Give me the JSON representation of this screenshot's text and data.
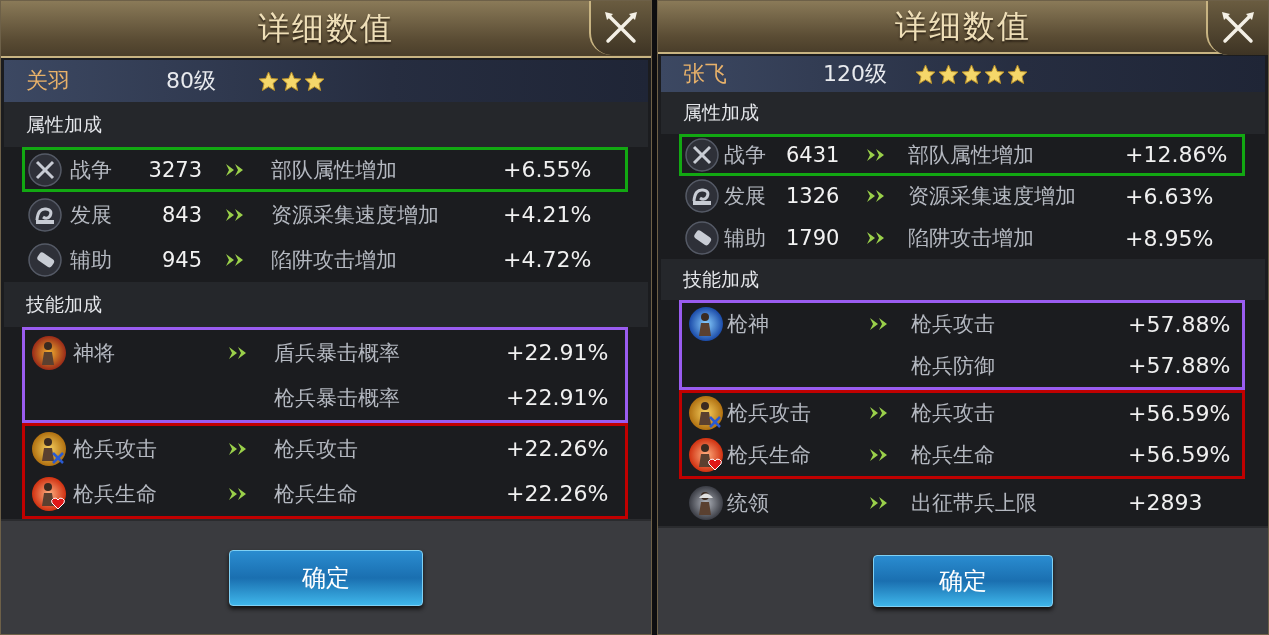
{
  "panels": [
    {
      "title": "详细数值",
      "hero": {
        "name": "关羽",
        "level": "80级",
        "stars": 3
      },
      "attributes": {
        "title": "属性加成",
        "rows": [
          {
            "kind": "war",
            "name": "战争",
            "points": "3273",
            "effect": "部队属性增加",
            "value": "+6.55%",
            "color": "#12a812"
          },
          {
            "kind": "development",
            "name": "发展",
            "points": "843",
            "effect": "资源采集速度增加",
            "value": "+4.21%"
          },
          {
            "kind": "support",
            "name": "辅助",
            "points": "945",
            "effect": "陷阱攻击增加",
            "value": "+4.72%"
          }
        ]
      },
      "skills": {
        "title": "技能加成",
        "groups": [
          {
            "color": "#9a5cf0",
            "skills": [
              {
                "kind": "general",
                "name": "神将",
                "effects": [
                  {
                    "effect": "盾兵暴击概率",
                    "value": "+22.91%"
                  },
                  {
                    "effect": "枪兵暴击概率",
                    "value": "+22.91%"
                  }
                ]
              }
            ]
          },
          {
            "color": "#c00000",
            "skills": [
              {
                "kind": "spear_attack",
                "name": "枪兵攻击",
                "effects": [
                  {
                    "effect": "枪兵攻击",
                    "value": "+22.26%"
                  }
                ]
              },
              {
                "kind": "spear_life",
                "name": "枪兵生命",
                "effects": [
                  {
                    "effect": "枪兵生命",
                    "value": "+22.26%"
                  }
                ]
              }
            ]
          }
        ]
      },
      "button": "确定"
    },
    {
      "title": "详细数值",
      "hero": {
        "name": "张飞",
        "level": "120级",
        "stars": 5
      },
      "attributes": {
        "title": "属性加成",
        "rows": [
          {
            "kind": "war",
            "name": "战争",
            "points": "6431",
            "effect": "部队属性增加",
            "value": "+12.86%",
            "color": "#12a812"
          },
          {
            "kind": "development",
            "name": "发展",
            "points": "1326",
            "effect": "资源采集速度增加",
            "value": "+6.63%"
          },
          {
            "kind": "support",
            "name": "辅助",
            "points": "1790",
            "effect": "陷阱攻击增加",
            "value": "+8.95%"
          }
        ]
      },
      "skills": {
        "title": "技能加成",
        "groups": [
          {
            "color": "#9a5cf0",
            "skills": [
              {
                "kind": "spear_god",
                "name": "枪神",
                "effects": [
                  {
                    "effect": "枪兵攻击",
                    "value": "+57.88%"
                  },
                  {
                    "effect": "枪兵防御",
                    "value": "+57.88%"
                  }
                ]
              }
            ]
          },
          {
            "color": "#c00000",
            "skills": [
              {
                "kind": "spear_attack",
                "name": "枪兵攻击",
                "effects": [
                  {
                    "effect": "枪兵攻击",
                    "value": "+56.59%"
                  }
                ]
              },
              {
                "kind": "spear_life",
                "name": "枪兵生命",
                "effects": [
                  {
                    "effect": "枪兵生命",
                    "value": "+56.59%"
                  }
                ]
              }
            ]
          },
          {
            "skills": [
              {
                "kind": "commander",
                "name": "统领",
                "effects": [
                  {
                    "effect": "出征带兵上限",
                    "value": "+2893"
                  }
                ]
              }
            ]
          }
        ]
      },
      "button": "确定"
    }
  ]
}
